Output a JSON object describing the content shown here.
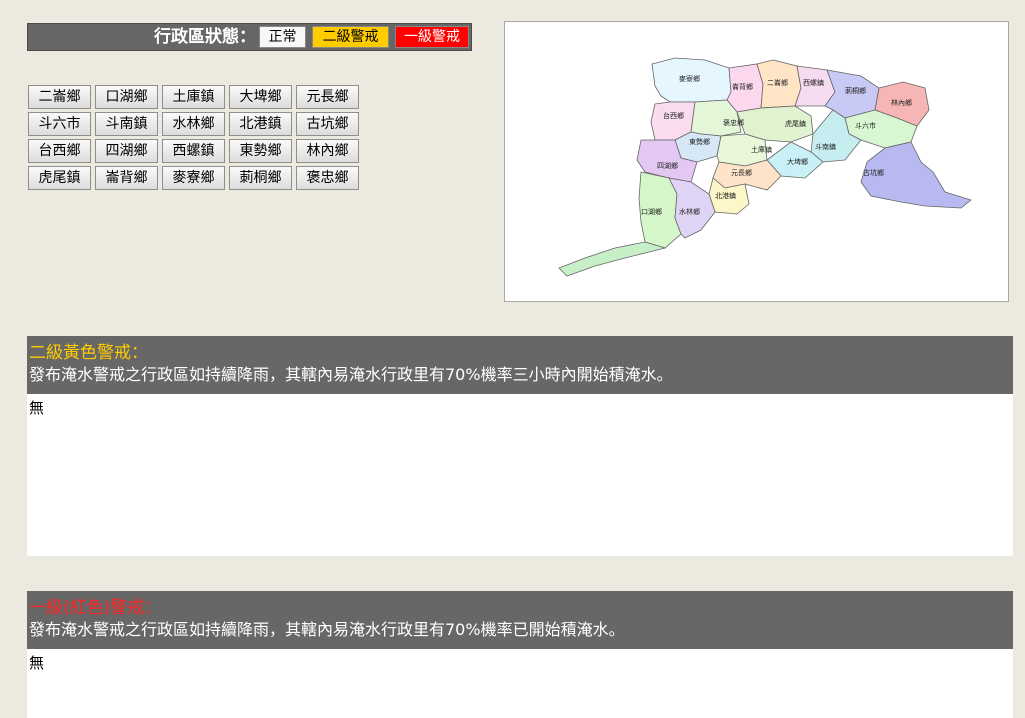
{
  "status": {
    "title": "行政區狀態：",
    "legend": {
      "normal": "正常",
      "yellow": "二級警戒",
      "red": "一級警戒"
    }
  },
  "districts": [
    "二崙鄉",
    "口湖鄉",
    "土庫鎮",
    "大埤鄉",
    "元長鄉",
    "斗六市",
    "斗南鎮",
    "水林鄉",
    "北港鎮",
    "古坑鄉",
    "台西鄉",
    "四湖鄉",
    "西螺鎮",
    "東勢鄉",
    "林內鄉",
    "虎尾鎮",
    "崙背鄉",
    "麥寮鄉",
    "莿桐鄉",
    "褒忠鄉"
  ],
  "map": {
    "labels": {
      "mailiao": "麥寮鄉",
      "lunbei": "崙背鄉",
      "erlun": "二崙鄉",
      "xiluo": "西螺鎮",
      "citong": "莿桐鄉",
      "linnei": "林內鄉",
      "taixi": "台西鄉",
      "baozhong": "褒忠鄉",
      "huwei": "虎尾鎮",
      "douliu": "斗六市",
      "dongshi": "東勢鄉",
      "tuku": "土庫鎮",
      "dounan": "斗南鎮",
      "sihu": "四湖鄉",
      "dapi": "大埤鄉",
      "yuanchang": "元長鄉",
      "gukeng": "古坑鄉",
      "beigang": "北港鎮",
      "kouhu": "口湖鄉",
      "shuilin": "水林鄉"
    }
  },
  "yellow_panel": {
    "title": "二級黃色警戒：",
    "description": "發布淹水警戒之行政區如持續降雨，其轄內易淹水行政里有70%機率三小時內開始積淹水。",
    "content": "無"
  },
  "red_panel": {
    "title": "一級(紅色)警戒：",
    "description": "發布淹水警戒之行政區如持續降雨，其轄內易淹水行政里有70%機率已開始積淹水。",
    "content": "無"
  },
  "colors": {
    "yellow_title": "#ffcc00",
    "red_title": "#ff2222",
    "header_bg": "#676767",
    "page_bg": "#ece9df"
  }
}
